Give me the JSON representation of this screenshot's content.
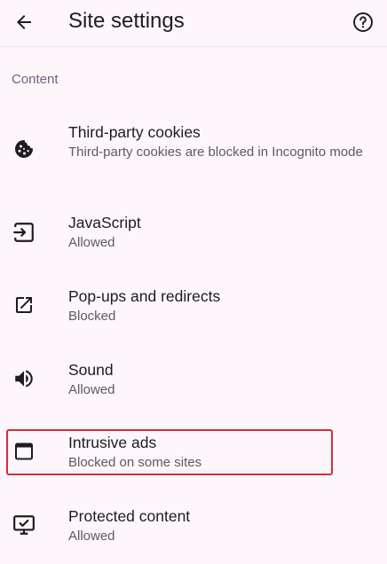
{
  "header": {
    "title": "Site settings"
  },
  "section": {
    "title": "Content"
  },
  "items": [
    {
      "label": "Third-party cookies",
      "summary": "Third-party cookies are blocked in Incognito mode",
      "icon": "cookie-icon"
    },
    {
      "label": "JavaScript",
      "summary": "Allowed",
      "icon": "javascript-icon"
    },
    {
      "label": "Pop-ups and redirects",
      "summary": "Blocked",
      "icon": "open-in-new-icon"
    },
    {
      "label": "Sound",
      "summary": "Allowed",
      "icon": "volume-icon"
    },
    {
      "label": "Intrusive ads",
      "summary": "Blocked on some sites",
      "icon": "ads-window-icon"
    },
    {
      "label": "Protected content",
      "summary": "Allowed",
      "icon": "protected-content-icon"
    }
  ],
  "colors": {
    "background": "#fdf7fb",
    "section_header": "#7a5a85",
    "highlight": "#d92b3a"
  }
}
